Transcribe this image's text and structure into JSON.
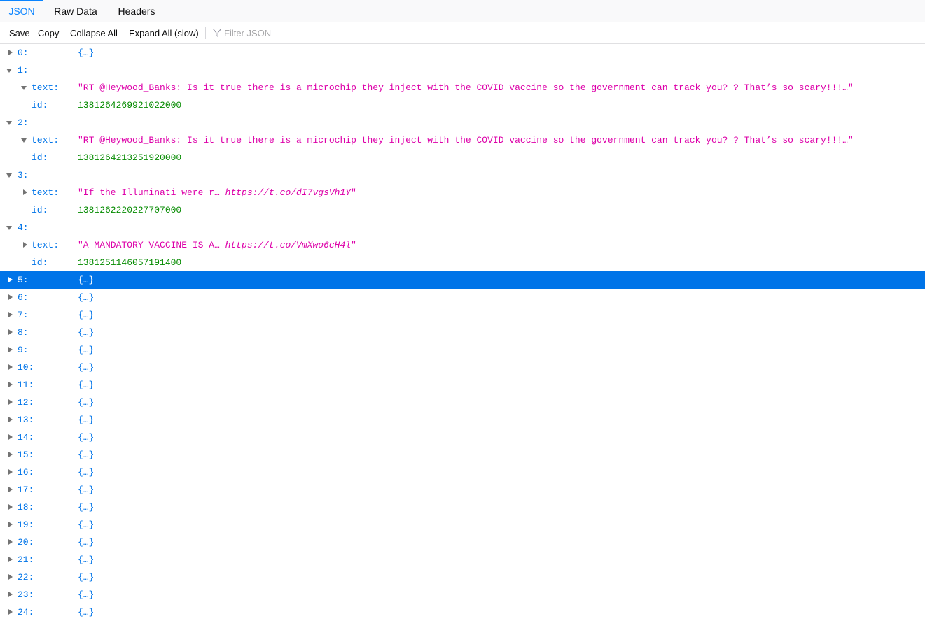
{
  "tabs": [
    "JSON",
    "Raw Data",
    "Headers"
  ],
  "toolbar": {
    "save": "Save",
    "copy": "Copy",
    "collapse_all": "Collapse All",
    "expand_all": "Expand All (slow)",
    "filter_placeholder": "Filter JSON"
  },
  "tree": {
    "collapsed_marker": "{…}",
    "keys": {
      "k0": "0:",
      "k1": "1:",
      "k2": "2:",
      "k3": "3:",
      "k4": "4:",
      "k5": "5:",
      "k6": "6:",
      "k7": "7:",
      "k8": "8:",
      "k9": "9:",
      "k10": "10:",
      "k11": "11:",
      "k12": "12:",
      "k13": "13:",
      "k14": "14:",
      "k15": "15:",
      "k16": "16:",
      "k17": "17:",
      "k18": "18:",
      "k19": "19:",
      "k20": "20:",
      "k21": "21:",
      "k22": "22:",
      "k23": "23:",
      "k24": "24:"
    },
    "field_text": "text:",
    "field_id": "id:",
    "item1": {
      "text": "\"RT @Heywood_Banks: Is it true there is a microchip they inject with the COVID vaccine so the government can track you? ? That’s so scary!!!…\"",
      "id": "1381264269921022000"
    },
    "item2": {
      "text": "\"RT @Heywood_Banks: Is it true there is a microchip they inject with the COVID vaccine so the government can track you? ? That’s so scary!!!…\"",
      "id": "1381264213251920000"
    },
    "item3": {
      "text_prefix": "\"If the Illuminati were r… ",
      "text_url": "https://t.co/dI7vgsVh1Y",
      "text_suffix": "\"",
      "id": "1381262220227707000"
    },
    "item4": {
      "text_prefix": "\"A MANDATORY VACCINE IS A… ",
      "text_url": "https://t.co/VmXwo6cH4l",
      "text_suffix": "\"",
      "id": "1381251146057191400"
    },
    "selected_key": "5:"
  },
  "colors": {
    "accent": "#0a84ff",
    "selection": "#0074e8",
    "key": "#0074e8",
    "string": "#dd00a9",
    "number": "#058b00"
  }
}
